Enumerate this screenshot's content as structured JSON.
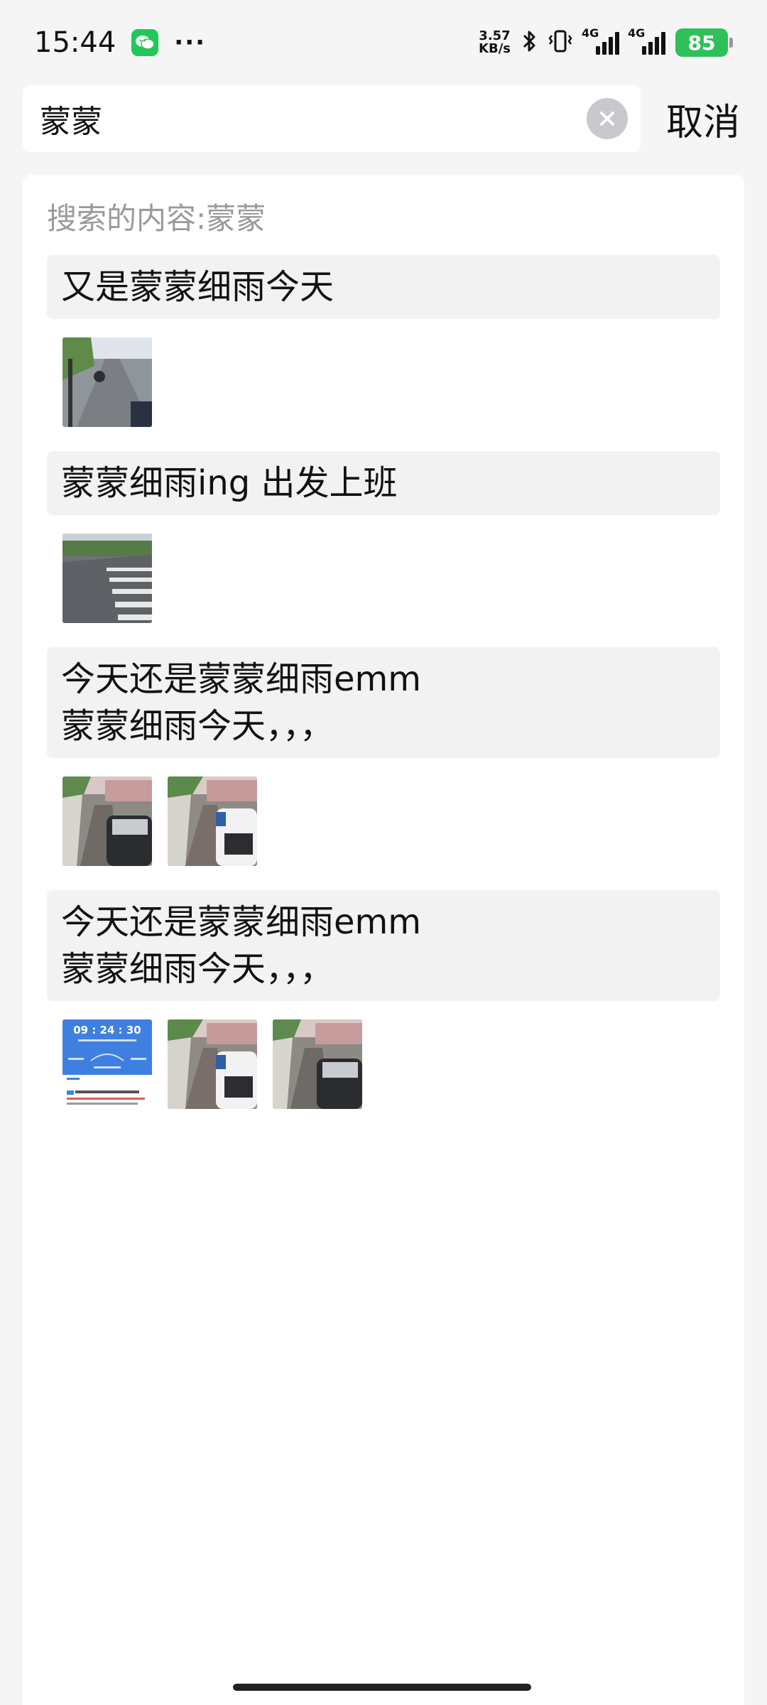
{
  "status_bar": {
    "time": "15:44",
    "more_dots": "···",
    "net_speed_value": "3.57",
    "net_speed_unit": "KB/s",
    "network_tag_1": "4G",
    "network_tag_2": "4G",
    "battery_level": "85",
    "icons": [
      "wechat-icon",
      "bluetooth-icon",
      "vibrate-icon",
      "signal-icon",
      "signal-icon",
      "battery-icon"
    ]
  },
  "search": {
    "value": "蒙蒙",
    "clear_icon": "close-icon",
    "cancel_label": "取消"
  },
  "results": {
    "hint": "搜索的内容:蒙蒙",
    "items": [
      {
        "text": "又是蒙蒙细雨今天",
        "images": [
          "street-photo"
        ]
      },
      {
        "text": "蒙蒙细雨ing 出发上班",
        "images": [
          "crosswalk-photo"
        ]
      },
      {
        "text": "今天还是蒙蒙细雨emm\n蒙蒙细雨今天，，，",
        "images": [
          "street-photo",
          "street-photo"
        ]
      },
      {
        "text": "今天还是蒙蒙细雨emm\n蒙蒙细雨今天，，，",
        "images": [
          "screenshot-thumbnail",
          "street-photo",
          "street-photo"
        ]
      }
    ],
    "screenshot_thumb_time": "09 : 24 : 30"
  },
  "colors": {
    "wechat_green": "#21c75a",
    "battery_green": "#2fc05a",
    "screenshot_blue": "#3f7fe0"
  }
}
